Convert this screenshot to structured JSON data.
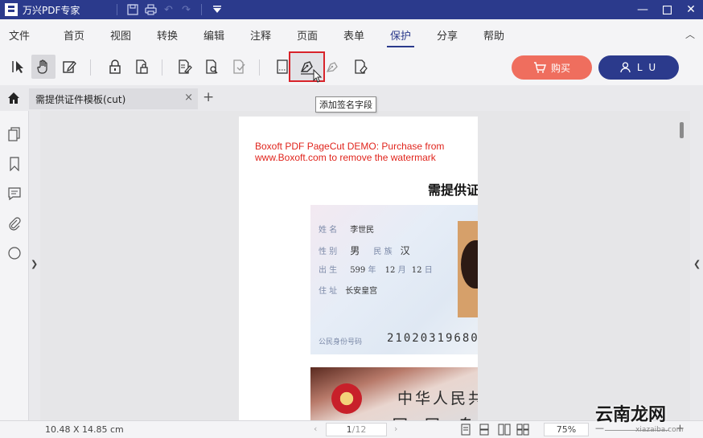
{
  "titlebar": {
    "app_title": "万兴PDF专家",
    "brand_color": "#2b3a8c"
  },
  "menu": {
    "items": [
      {
        "label": "文件"
      },
      {
        "label": "首页"
      },
      {
        "label": "视图"
      },
      {
        "label": "转换"
      },
      {
        "label": "编辑"
      },
      {
        "label": "注释"
      },
      {
        "label": "页面"
      },
      {
        "label": "表单"
      },
      {
        "label": "保护",
        "active": true
      },
      {
        "label": "分享"
      },
      {
        "label": "帮助"
      }
    ]
  },
  "toolbar": {
    "buy_label": "购买",
    "user_label": "L U",
    "buy_color": "#ef6e5e",
    "tooltip": "添加签名字段"
  },
  "tabs": {
    "doc_tab_label": "需提供证件模板(cut)",
    "close_icon": "×",
    "add_icon": "+"
  },
  "document": {
    "watermark_line1": "Boxoft PDF PageCut DEMO: Purchase from",
    "watermark_line2": "www.Boxoft.com to remove the watermark",
    "heading": "需提供证",
    "id_front": {
      "name_label": "姓 名",
      "name_value": "李世民",
      "sex_label": "性 别",
      "sex_value": "男",
      "ethnic_label": "民 族",
      "ethnic_value": "汉",
      "birth_label": "出 生",
      "birth_year": "599",
      "birth_month": "12",
      "birth_day": "12",
      "year_unit": "年",
      "month_unit": "月",
      "day_unit": "日",
      "addr_label": "住 址",
      "addr_value": "长安皇宫",
      "number_label": "公民身份号码",
      "number_value": "21020319680"
    },
    "id_back": {
      "line1": "中华人民共",
      "line2": "居 民 身"
    }
  },
  "status": {
    "page_size": "10.48 X 14.85 cm",
    "current_page": "1",
    "total_pages": "/12",
    "zoom": "75%"
  },
  "site_watermark": {
    "text": "云南龙网",
    "url": "xiazaiba.com"
  }
}
